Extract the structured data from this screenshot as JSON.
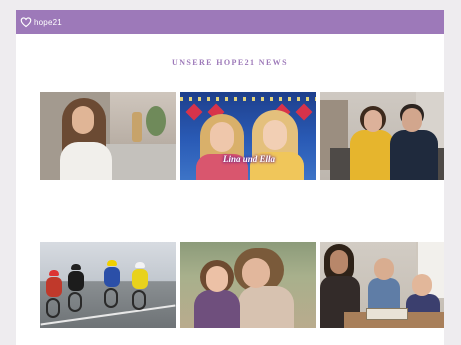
{
  "header": {
    "logo_text": "hope21",
    "nav": [
      "",
      ""
    ]
  },
  "page_title": "UNSERE HOPE21 NEWS",
  "posts": [
    {
      "caption": "",
      "excerpt": ""
    },
    {
      "caption": "",
      "excerpt": "",
      "image_text": "Lina und Ella"
    },
    {
      "caption": "",
      "excerpt": ""
    },
    {
      "caption": "",
      "excerpt": ""
    },
    {
      "caption": "",
      "excerpt": ""
    },
    {
      "caption": "",
      "excerpt": ""
    }
  ],
  "colors": {
    "brand_purple": "#9d79b9",
    "title_purple": "#9d79b9"
  }
}
